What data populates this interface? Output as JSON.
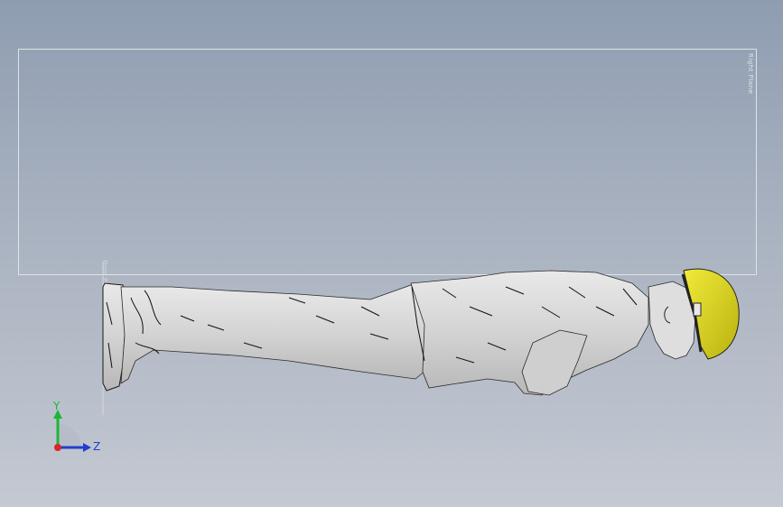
{
  "viewport": {
    "plane_label": "Right Plane",
    "plane2_label": "Front Plane"
  },
  "triad": {
    "y_label": "Y",
    "z_label": "Z",
    "colors": {
      "y": "#1db53a",
      "z": "#1f3fcf",
      "x": "#d8262a"
    }
  },
  "model": {
    "name_icon": "worker-figure-model",
    "helmet_color": "#e4dc1a",
    "body_color": "#d9d9d9"
  }
}
